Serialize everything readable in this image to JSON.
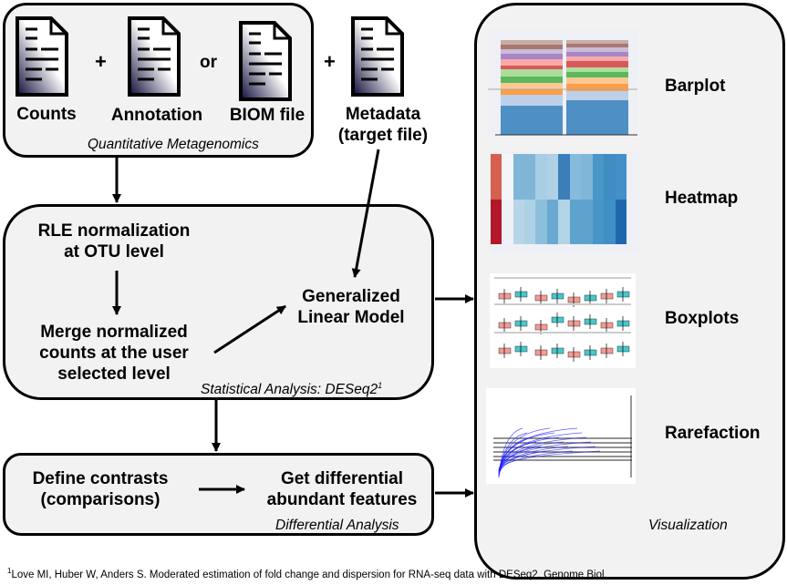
{
  "inputs": {
    "counts_label": "Counts",
    "annotation_label": "Annotation",
    "biom_label": "BIOM file",
    "metadata_label_1": "Metadata",
    "metadata_label_2": "(target file)",
    "plus": "+",
    "or": "or",
    "caption": "Quantitative Metagenomics",
    "icons": [
      "document-icon",
      "document-icon",
      "document-icon",
      "document-icon"
    ]
  },
  "statistical": {
    "rle_1": "RLE normalization",
    "rle_2": "at OTU level",
    "merge_1": "Merge normalized",
    "merge_2": "counts at the user",
    "merge_3": "selected level",
    "glm_1": "Generalized",
    "glm_2": "Linear Model",
    "caption": "Statistical Analysis: DESeq2",
    "caption_sup": "1"
  },
  "differential": {
    "contrasts_1": "Define contrasts",
    "contrasts_2": "(comparisons)",
    "features_1": "Get differential",
    "features_2": "abundant features",
    "caption": "Differential Analysis"
  },
  "visualization": {
    "caption": "Visualization",
    "items": [
      {
        "label": "Barplot"
      },
      {
        "label": "Heatmap"
      },
      {
        "label": "Boxplots"
      },
      {
        "label": "Rarefaction"
      }
    ]
  },
  "footnote": {
    "sup": "1",
    "text": "Love MI, Huber W, Anders S. Moderated estimation of fold change and dispersion for RNA-seq data with DESeq2. Genome Biol."
  }
}
